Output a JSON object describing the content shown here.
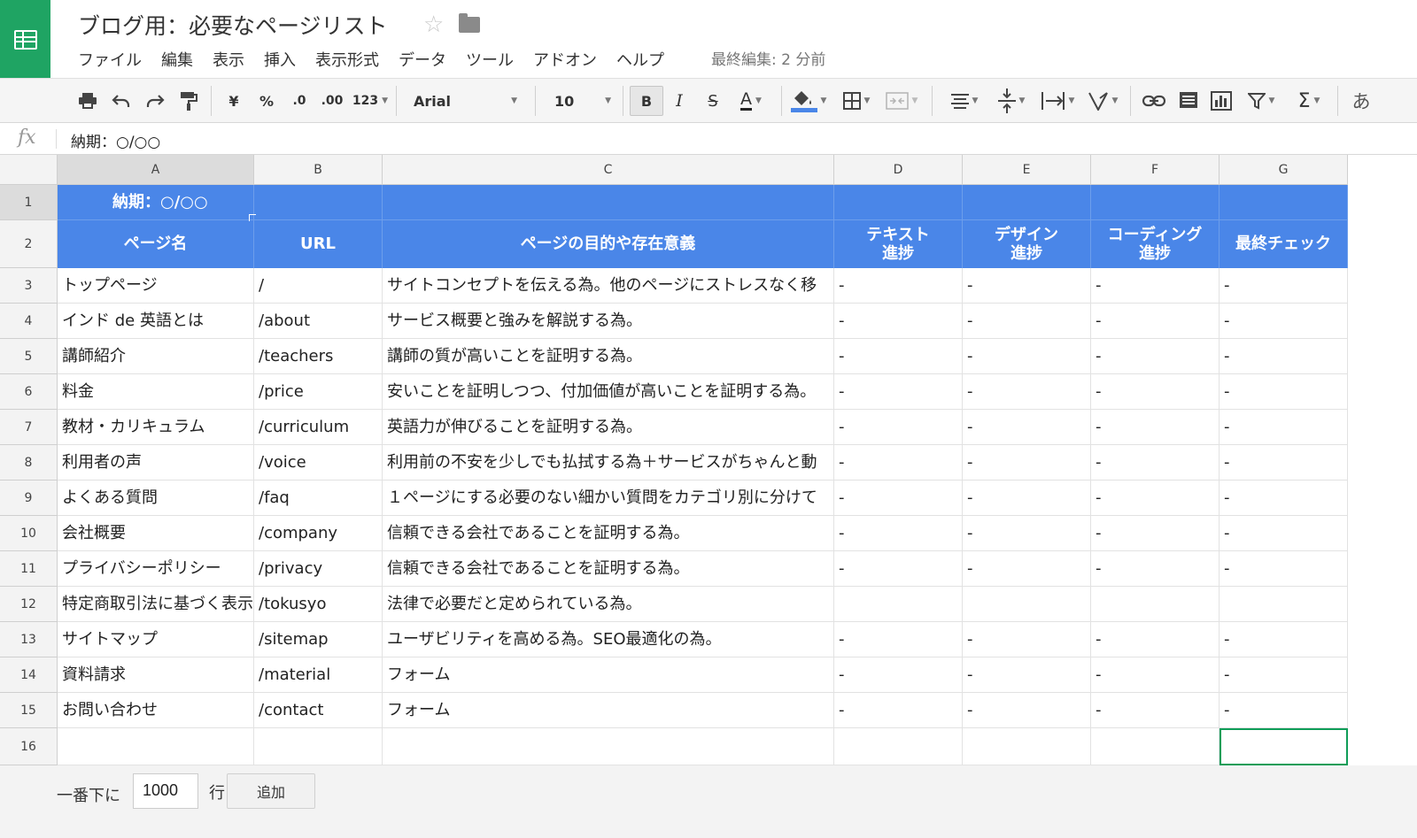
{
  "app": {
    "title": "ブログ用：必要なページリスト",
    "last_edit": "最終編集: 2 分前",
    "menu": [
      "ファイル",
      "編集",
      "表示",
      "挿入",
      "表示形式",
      "データ",
      "ツール",
      "アドオン",
      "ヘルプ"
    ]
  },
  "toolbar": {
    "currency_label": "¥",
    "percent_label": "%",
    "decrease_decimal_label": ".0",
    "increase_decimal_label": ".00",
    "more_formats_label": "123",
    "font": "Arial",
    "font_size": "10",
    "bold_label": "B",
    "italic_label": "I",
    "strike_label": "S",
    "text_color_label": "A",
    "input_tools_label": "あ"
  },
  "formula_bar": {
    "fx_label": "fx",
    "content": "納期：○/○○"
  },
  "sheet": {
    "columns": [
      "A",
      "B",
      "C",
      "D",
      "E",
      "F",
      "G"
    ],
    "row_numbers": [
      "1",
      "2",
      "3",
      "4",
      "5",
      "6",
      "7",
      "8",
      "9",
      "10",
      "11",
      "12",
      "13",
      "14",
      "15",
      "16"
    ],
    "header_row1": {
      "a": "納期：○/○○"
    },
    "header_row2": [
      "ページ名",
      "URL",
      "ページの目的や存在意義",
      "テキスト\n進捗",
      "デザイン\n進捗",
      "コーディング\n進捗",
      "最終チェック"
    ],
    "rows": [
      [
        "トップページ",
        "/",
        "サイトコンセプトを伝える為。他のページにストレスなく移",
        "-",
        "-",
        "-",
        "-"
      ],
      [
        "インド de 英語とは",
        "/about",
        "サービス概要と強みを解説する為。",
        "-",
        "-",
        "-",
        "-"
      ],
      [
        "講師紹介",
        "/teachers",
        "講師の質が高いことを証明する為。",
        "-",
        "-",
        "-",
        "-"
      ],
      [
        "料金",
        "/price",
        "安いことを証明しつつ、付加価値が高いことを証明する為。",
        "-",
        "-",
        "-",
        "-"
      ],
      [
        "教材・カリキュラム",
        "/curriculum",
        "英語力が伸びることを証明する為。",
        "-",
        "-",
        "-",
        "-"
      ],
      [
        "利用者の声",
        "/voice",
        "利用前の不安を少しでも払拭する為＋サービスがちゃんと動",
        "-",
        "-",
        "-",
        "-"
      ],
      [
        "よくある質問",
        "/faq",
        "１ページにする必要のない細かい質問をカテゴリ別に分けて",
        "-",
        "-",
        "-",
        "-"
      ],
      [
        "会社概要",
        "/company",
        "信頼できる会社であることを証明する為。",
        "-",
        "-",
        "-",
        "-"
      ],
      [
        "プライバシーポリシー",
        "/privacy",
        "信頼できる会社であることを証明する為。",
        "-",
        "-",
        "-",
        "-"
      ],
      [
        "特定商取引法に基づく表示",
        "/tokusyo",
        "法律で必要だと定められている為。",
        "",
        "",
        "",
        ""
      ],
      [
        "サイトマップ",
        "/sitemap",
        "ユーザビリティを高める為。SEO最適化の為。",
        "-",
        "-",
        "-",
        "-"
      ],
      [
        "資料請求",
        "/material",
        "フォーム",
        "-",
        "-",
        "-",
        "-"
      ],
      [
        "お問い合わせ",
        "/contact",
        "フォーム",
        "-",
        "-",
        "-",
        "-"
      ],
      [
        "",
        "",
        "",
        "",
        "",
        "",
        ""
      ]
    ]
  },
  "footer": {
    "label": "一番下に",
    "rows_value": "1000",
    "rows_suffix": "行",
    "add_label": "追加"
  },
  "colors": {
    "brand_green": "#1fa463",
    "header_blue": "#4a86e8",
    "selection_green": "#0f9d58"
  }
}
